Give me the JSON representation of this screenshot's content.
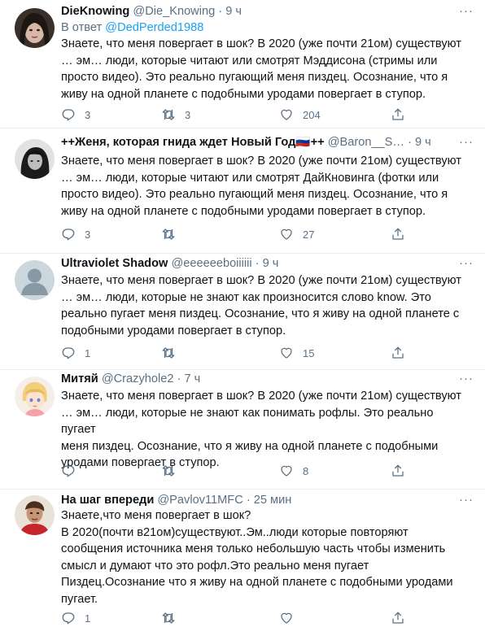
{
  "tweets": [
    {
      "name": "DieKnowing",
      "handle": "@Die_Knowing",
      "dot": "·",
      "time": "9 ч",
      "reply_prefix": "В ответ",
      "reply_to": "@DedPerded1988",
      "text": "Знаете, что меня повергает в шок? В 2020 (уже почти 21ом) существуют\n… эм… люди, которые читают или смотрят Мэддисона (стримы или\nпросто видео). Это реально пугающий меня пиздец. Осознание, что я\nживу на одной планете с подобными уродами повергает в ступор.",
      "replies": "3",
      "retweets": "3",
      "likes": "204",
      "avatar": "dark-haired-woman"
    },
    {
      "name": "++Женя, которая гнида ждет Новый Год🇷🇺++",
      "handle": "@Baron__S…",
      "dot": "·",
      "time": "9 ч",
      "text": "Знаете, что меня повергает в шок? В 2020 (уже почти 21ом) существуют\n… эм… люди, которые читают или смотрят ДайКновинга (фотки или\nпросто видео). Это реально пугающий меня пиздец. Осознание, что я\nживу на одной планете с подобными уродами повергает в ступор.",
      "replies": "3",
      "retweets": "",
      "likes": "27",
      "avatar": "monochrome-portrait"
    },
    {
      "name": "Ultraviolet Shadow",
      "handle": "@eeeeeeboiiiiii",
      "dot": "·",
      "time": "9 ч",
      "text": "Знаете, что меня повергает в шок? В 2020 (уже почти 21ом) существуют\n… эм… люди, которые не знают как произносится слово know. Это\nреально пугает меня пиздец. Осознание, что я живу на одной планете с\nподобными уродами повергает в ступор.",
      "replies": "1",
      "retweets": "",
      "likes": "15",
      "avatar": "default-silhouette"
    },
    {
      "name": "Митяй",
      "handle": "@Crazyhole2",
      "dot": "·",
      "time": "7 ч",
      "text": "Знаете, что меня повергает в шок? В 2020 (уже почти 21ом) существуют\n… эм… люди, которые не знают как понимать рофлы. Это реально пугает\nменя пиздец. Осознание, что я живу на одной планете с подобными\nуродами повергает в ступор.",
      "replies": "",
      "retweets": "",
      "likes": "8",
      "avatar": "anime-character"
    },
    {
      "name": "На шаг впереди",
      "handle": "@Pavlov11MFC",
      "dot": "·",
      "time": "25 мин",
      "text": "Знаете,что меня повергает в шок?\nВ 2020(почти в21ом)существуют..Эм..люди которые повторяют\nсообщения источника меня только небольшую часть чтобы изменить\nсмысл и думают что это рофл.Это реально меня пугает\nПиздец.Осознание что я живу  на одной планете с подобными уродами\nпугает.",
      "replies": "1",
      "retweets": "",
      "likes": "",
      "avatar": "man-red-shirt"
    }
  ],
  "icons": {
    "reply": "reply-icon",
    "retweet": "retweet-icon",
    "like": "heart-icon",
    "share": "share-icon",
    "more": "more-icon"
  },
  "colors": {
    "text": "#0f1419",
    "secondary": "#5b7083",
    "link": "#1da1f2",
    "divider": "#e6ecf0"
  }
}
